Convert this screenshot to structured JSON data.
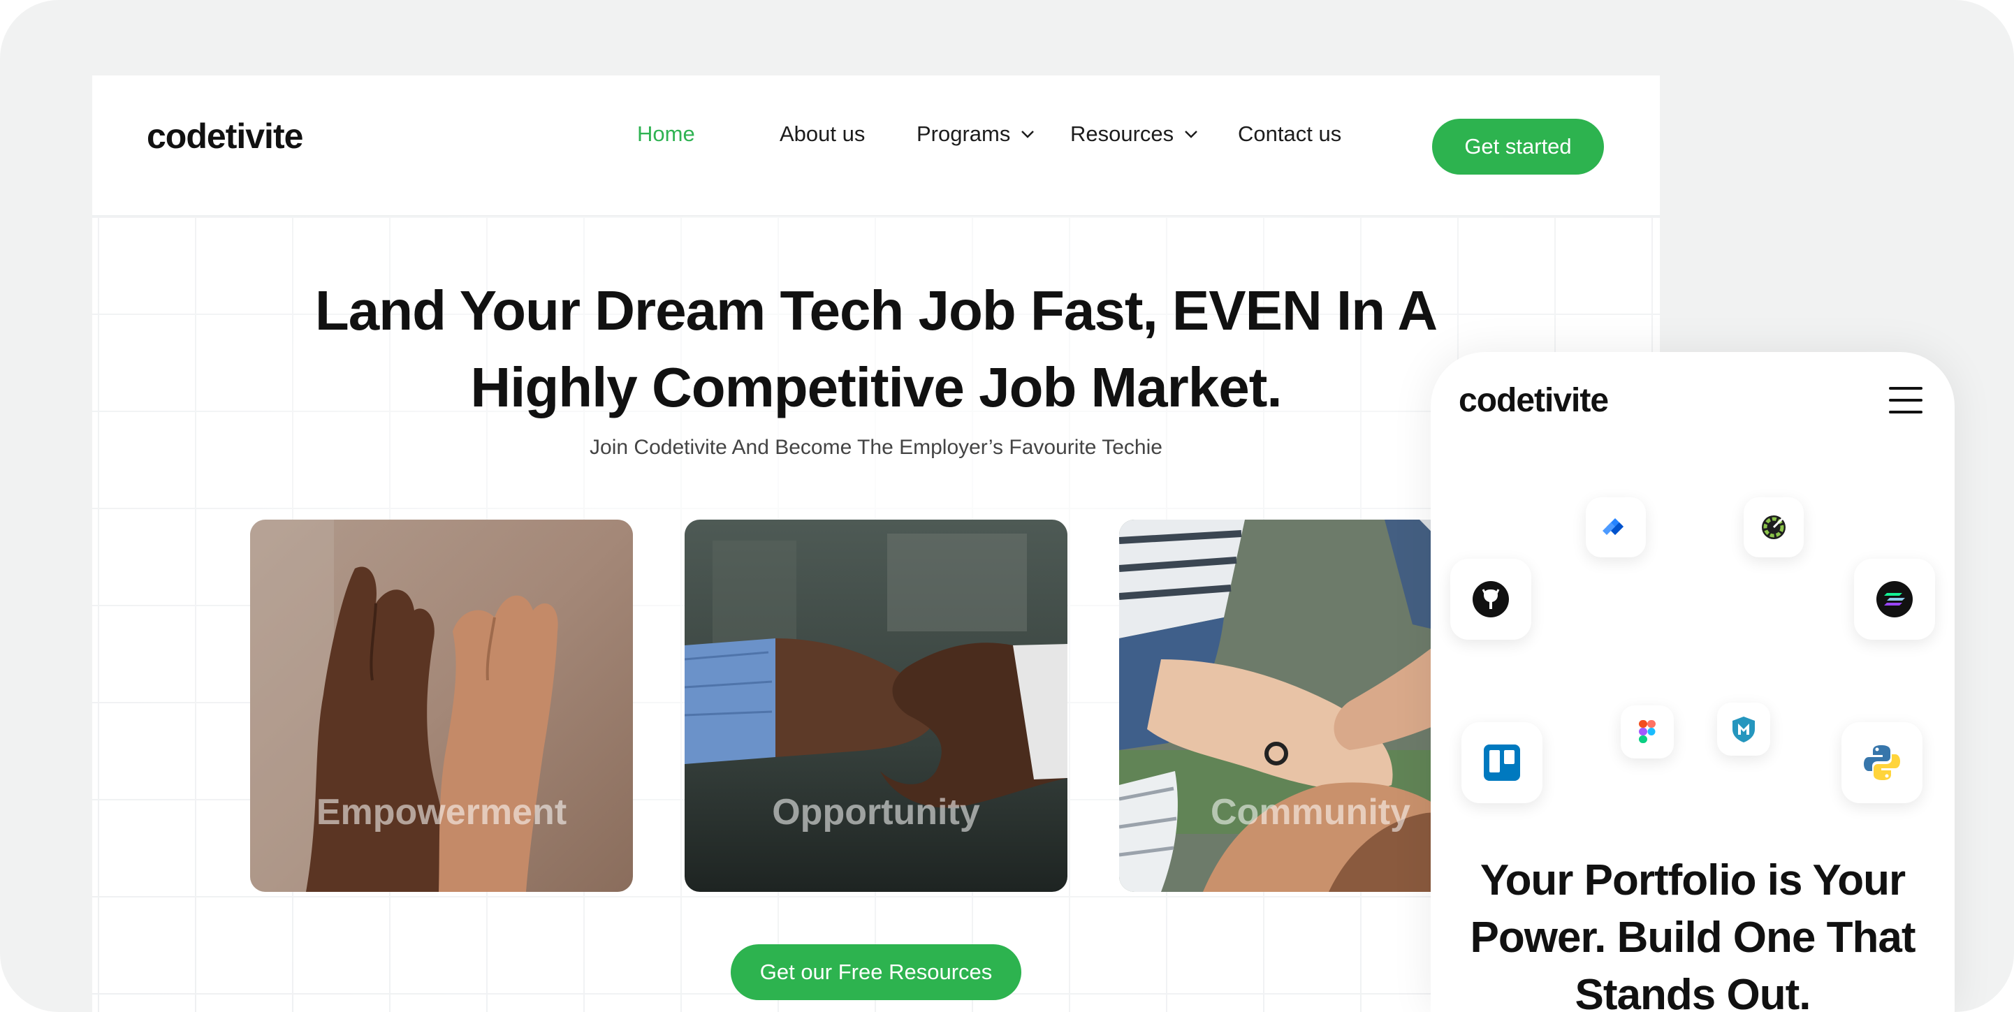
{
  "brand": {
    "logo_text": "codetivite",
    "accent_color": "#2db34f"
  },
  "nav": {
    "items": [
      {
        "label": "Home",
        "active": true
      },
      {
        "label": "About us"
      },
      {
        "label": "Programs",
        "dropdown": true
      },
      {
        "label": "Resources",
        "dropdown": true
      },
      {
        "label": "Contact us"
      }
    ],
    "cta_label": "Get started"
  },
  "hero": {
    "title_line1": "Land Your Dream Tech Job Fast, EVEN In A",
    "title_line2": "Highly Competitive Job Market.",
    "subtitle": "Join Codetivite And Become The Employer’s  Favourite Techie"
  },
  "cards": [
    {
      "label": "Empowerment"
    },
    {
      "label": "Opportunity"
    },
    {
      "label": "Community"
    }
  ],
  "resources_button": "Get our Free Resources",
  "mobile": {
    "logo_text": "codetivite",
    "menu_icon": "hamburger-icon",
    "tool_icons": [
      "jira-icon",
      "grafana-icon",
      "github-icon",
      "solana-icon",
      "trello-icon",
      "figma-icon",
      "metasploit-icon",
      "python-icon"
    ],
    "title_line1": "Your Portfolio is Your",
    "title_line2": "Power. Build One That",
    "title_line3": "Stands Out."
  }
}
